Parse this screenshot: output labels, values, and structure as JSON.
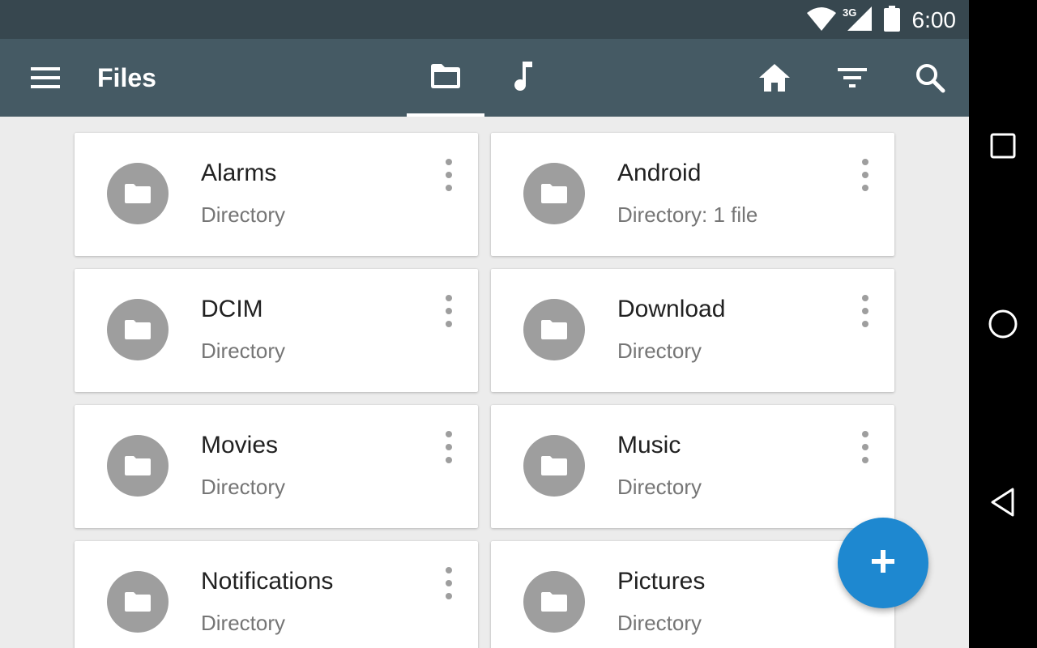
{
  "status_bar": {
    "network_label": "3G",
    "time": "6:00"
  },
  "toolbar": {
    "title": "Files",
    "tabs": [
      {
        "icon": "folder-icon",
        "active": true
      },
      {
        "icon": "music-note-icon",
        "active": false
      }
    ],
    "actions": [
      "home-icon",
      "filter-icon",
      "search-icon"
    ],
    "menu_icon": "hamburger-menu-icon"
  },
  "files": [
    {
      "name": "Alarms",
      "detail": "Directory"
    },
    {
      "name": "Android",
      "detail": "Directory: 1 file"
    },
    {
      "name": "DCIM",
      "detail": "Directory"
    },
    {
      "name": "Download",
      "detail": "Directory"
    },
    {
      "name": "Movies",
      "detail": "Directory"
    },
    {
      "name": "Music",
      "detail": "Directory"
    },
    {
      "name": "Notifications",
      "detail": "Directory"
    },
    {
      "name": "Pictures",
      "detail": "Directory"
    }
  ],
  "fab": {
    "icon": "plus-icon"
  },
  "nav_bar": [
    "recents-square-icon",
    "home-circle-icon",
    "back-triangle-icon"
  ],
  "colors": {
    "status_bar": "#37474f",
    "toolbar": "#455a64",
    "background": "#ececec",
    "fab": "#1e88d0",
    "avatar": "#9e9e9e"
  }
}
